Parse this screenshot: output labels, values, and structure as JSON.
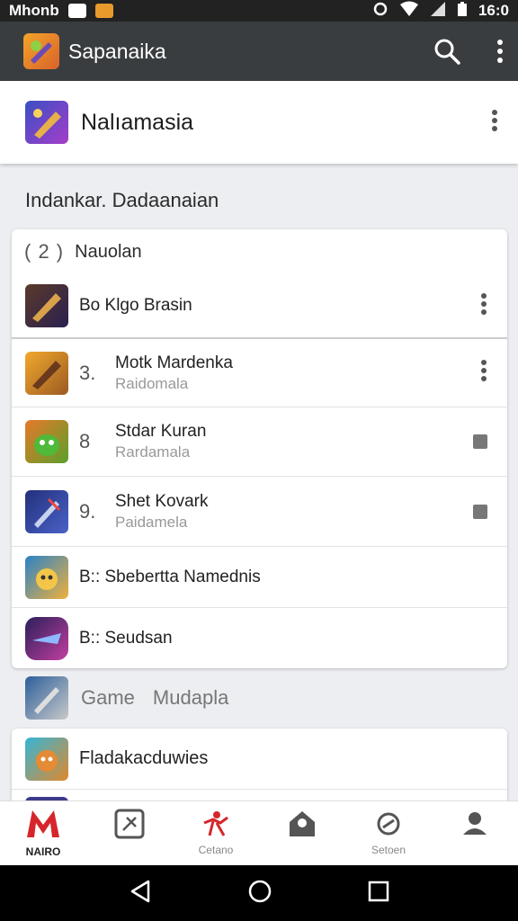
{
  "status_bar": {
    "carrier": "Mhonb",
    "time": "16:0"
  },
  "app_bar": {
    "title": "Sapanaika",
    "search_icon": "search-icon",
    "menu_icon": "more-vert-icon"
  },
  "selected_app": {
    "name": "Nalıamasia"
  },
  "section_title": "Indankar. Dadaanaian",
  "list": {
    "count": "( 2 )",
    "label": "Nauolan",
    "rows": [
      {
        "num": "",
        "title": "Bo Klgo Brasin",
        "subtitle": ""
      },
      {
        "num": "3.",
        "title": "Motk Mardenka",
        "subtitle": "Raidomala"
      },
      {
        "num": "8",
        "title": "Stdar Kuran",
        "subtitle": "Rardamala"
      },
      {
        "num": "9.",
        "title": "Shet Kovark",
        "subtitle": "Paidamela"
      },
      {
        "num": "",
        "title": "B:: Sbebertta Namednis",
        "subtitle": ""
      },
      {
        "num": "",
        "title": "B:: Seudsan",
        "subtitle": ""
      }
    ]
  },
  "game_section": {
    "label1": "Game",
    "label2": "Mudapla"
  },
  "second_card": {
    "title": "Fladakacduwies"
  },
  "bottom_nav": [
    {
      "label": "NAIRO",
      "icon": "logo-m-icon"
    },
    {
      "label": "",
      "icon": "puzzle-icon"
    },
    {
      "label": "Cetano",
      "icon": "runner-icon"
    },
    {
      "label": "",
      "icon": "profile-icon"
    },
    {
      "label": "Setoen",
      "icon": "compass-icon"
    },
    {
      "label": "",
      "icon": "account-icon"
    }
  ],
  "colors": {
    "appbar": "#3a3d40",
    "accent_red": "#d6262b",
    "status_bar": "#222222"
  }
}
